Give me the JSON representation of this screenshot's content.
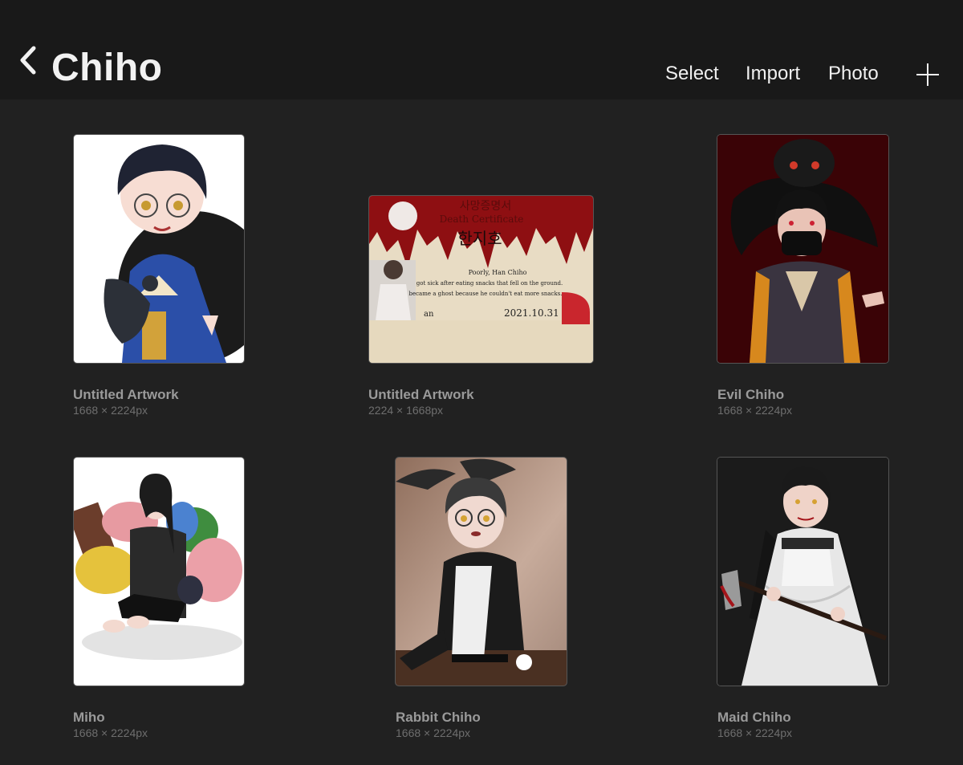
{
  "header": {
    "title": "Chiho",
    "back_icon": "chevron-left-icon",
    "actions": {
      "select": "Select",
      "import": "Import",
      "photo": "Photo"
    },
    "add_icon": "plus-icon"
  },
  "artworks": [
    {
      "name": "Untitled Artwork",
      "size": "1668 × 2224px"
    },
    {
      "name": "Untitled Artwork",
      "size": "2224 × 1668px"
    },
    {
      "name": "Evil Chiho",
      "size": "1668 × 2224px"
    },
    {
      "name": "Miho",
      "size": "1668 × 2224px"
    },
    {
      "name": "Rabbit Chiho",
      "size": "1668 × 2224px"
    },
    {
      "name": "Maid Chiho",
      "size": "1668 × 2224px"
    }
  ],
  "certificate": {
    "korean_title": "사망증명서",
    "english_title": "Death Certificate",
    "name_korean": "한지호",
    "line_poorly": "Poorly, Han Chiho",
    "line_sick": "got sick after eating snacks that fell on the ground.",
    "line_ghost": "became a ghost because he couldn't eat more snacks.",
    "date": "2021.10.31",
    "signature_fragment": "an"
  },
  "colors": {
    "background": "#212121",
    "topbar": "#191919",
    "text": "#f0f0f0",
    "label": "#9a9a9a",
    "sublabel": "#6e6e6e"
  }
}
